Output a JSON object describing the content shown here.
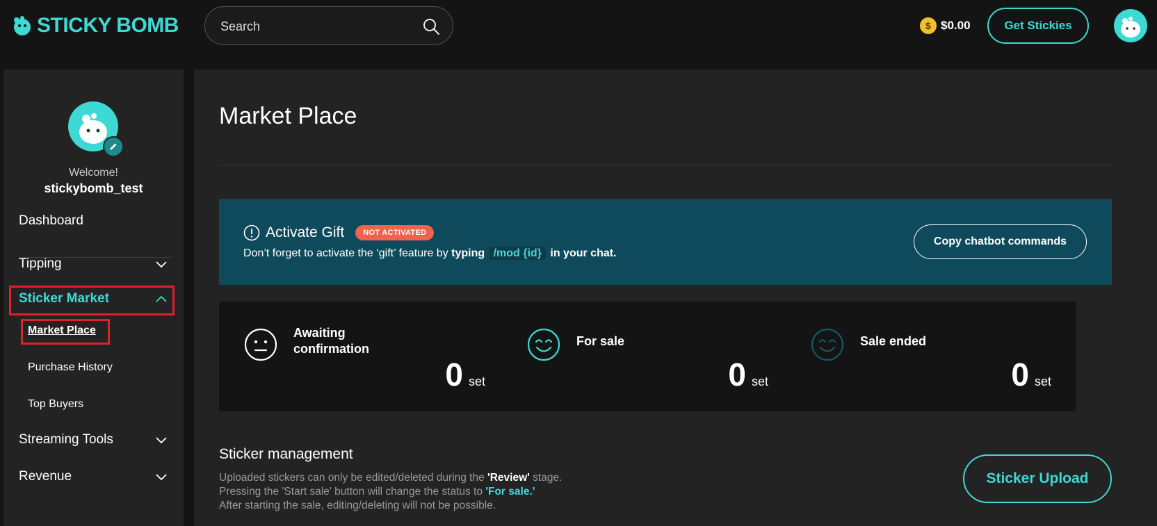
{
  "brand": {
    "name": "STICKY BOMB",
    "accent": "#3ed9d4"
  },
  "header": {
    "search_placeholder": "Search",
    "balance": "$0.00",
    "coin_symbol": "$",
    "get_stickies": "Get Stickies"
  },
  "sidebar": {
    "welcome": "Welcome!",
    "username": "stickybomb_test",
    "items": [
      {
        "label": "Dashboard"
      },
      {
        "label": "Tipping"
      },
      {
        "label": "Sticker Market"
      },
      {
        "label": "Streaming Tools"
      },
      {
        "label": "Revenue"
      }
    ],
    "sub_items": [
      {
        "label": "Market Place"
      },
      {
        "label": "Purchase History"
      },
      {
        "label": "Top Buyers"
      }
    ]
  },
  "main": {
    "title": "Market Place",
    "banner": {
      "title": "Activate Gift",
      "badge": "NOT ACTIVATED",
      "desc_prefix": "Don’t forget to activate the ‘gift’ feature by",
      "desc_typing": "typing",
      "desc_code": "/mod {id}",
      "desc_suffix": "in your chat.",
      "button": "Copy chatbot commands"
    },
    "stats": [
      {
        "label_line1": "Awaiting",
        "label_line2": "confirmation",
        "value": "0",
        "unit": "set",
        "icon": "neutral-face-icon"
      },
      {
        "label_line1": "For sale",
        "value": "0",
        "unit": "set",
        "icon": "smile-face-icon"
      },
      {
        "label_line1": "Sale ended",
        "value": "0",
        "unit": "set",
        "icon": "dim-smile-face-icon"
      }
    ],
    "management": {
      "title": "Sticker management",
      "line1_prefix": "Uploaded stickers can only be edited/deleted during the",
      "line1_bold": "'Review'",
      "line1_suffix": "stage.",
      "line2_prefix": "Pressing the 'Start sale' button will change the status to",
      "line2_bold": "'For sale.'",
      "line3": "After starting the sale, editing/deleting will not be possible.",
      "upload_button": "Sticker Upload"
    }
  }
}
